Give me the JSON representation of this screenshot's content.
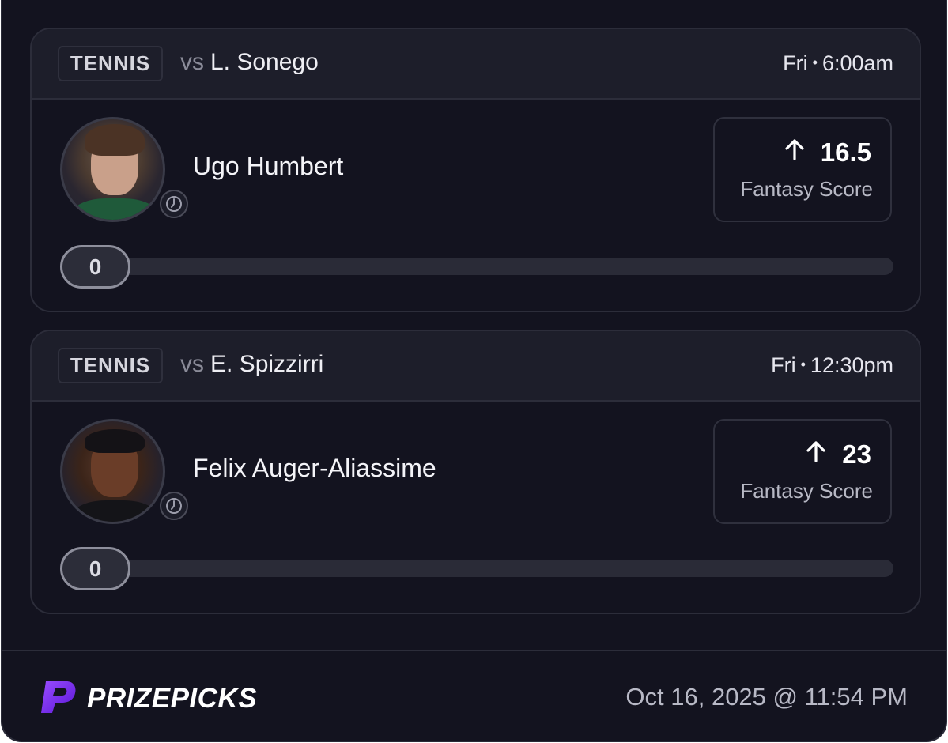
{
  "cards": [
    {
      "sport": "TENNIS",
      "vs_prefix": "vs",
      "opponent": "L. Sonego",
      "day": "Fri",
      "separator": "•",
      "time": "6:00am",
      "player": "Ugo Humbert",
      "direction": "up",
      "line": "16.5",
      "stat": "Fantasy Score",
      "current": "0",
      "progress": 0
    },
    {
      "sport": "TENNIS",
      "vs_prefix": "vs",
      "opponent": "E. Spizzirri",
      "day": "Fri",
      "separator": "•",
      "time": "12:30pm",
      "player": "Felix Auger-Aliassime",
      "direction": "up",
      "line": "23",
      "stat": "Fantasy Score",
      "current": "0",
      "progress": 0
    }
  ],
  "footer": {
    "brand": "PRIZEPICKS",
    "timestamp": "Oct 16, 2025 @ 11:54 PM"
  },
  "icons": {
    "arrow": "arrow-up-icon",
    "clock": "clock-icon",
    "logo": "prizepicks-logo-icon"
  },
  "colors": {
    "background": "#13131f",
    "header": "#1d1e2a",
    "brand_purple": "#7b2cf0"
  }
}
